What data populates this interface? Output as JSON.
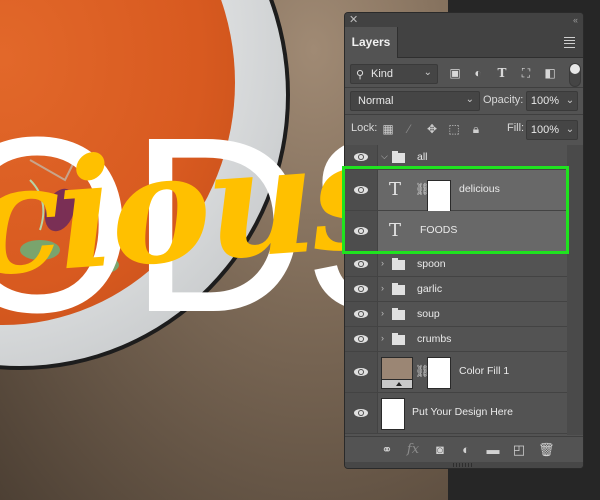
{
  "canvas": {
    "foods_text": "ODS",
    "delicious_text": "cious",
    "colors": {
      "text_white": "#ffffff",
      "text_yellow": "#ffc000",
      "soup": "#d85a20",
      "background": "#7d6a57"
    }
  },
  "panel": {
    "close_icon": "close-icon",
    "collapse_icon": "double-chevron-left-icon",
    "tab_label": "Layers",
    "menu_icon": "hamburger-menu-icon",
    "filter": {
      "kind_label": "Kind",
      "icons": [
        "image-filter-icon",
        "adjustment-filter-icon",
        "type-filter-icon",
        "shape-filter-icon",
        "smart-object-filter-icon"
      ]
    },
    "blend_mode": "Normal",
    "opacity_label": "Opacity:",
    "opacity_value": "100%",
    "lock_label": "Lock:",
    "lock_icons": [
      "lock-transparency-icon",
      "lock-paint-icon",
      "lock-position-icon",
      "lock-artboard-icon",
      "lock-all-icon"
    ],
    "fill_label": "Fill:",
    "fill_value": "100%",
    "layers": [
      {
        "name": "all",
        "type": "group",
        "expanded": true,
        "visible": true
      },
      {
        "name": "delicious",
        "type": "text",
        "has_mask": true,
        "visible": true,
        "selected": true
      },
      {
        "name": "FOODS",
        "type": "text",
        "visible": true,
        "selected": true
      },
      {
        "name": "spoon",
        "type": "group",
        "expanded": false,
        "visible": true
      },
      {
        "name": "garlic",
        "type": "group",
        "expanded": false,
        "visible": true
      },
      {
        "name": "soup",
        "type": "group",
        "expanded": false,
        "visible": true
      },
      {
        "name": "crumbs",
        "type": "group",
        "expanded": false,
        "visible": true
      },
      {
        "name": "Color Fill 1",
        "type": "fill",
        "has_mask": true,
        "visible": true,
        "fill_color": "#9b8674"
      },
      {
        "name": "Put Your Design Here",
        "type": "smart-object",
        "visible": true
      }
    ],
    "bottom_icons": [
      "link-layers-icon",
      "fx-icon",
      "add-mask-icon",
      "adjustment-layer-icon",
      "new-group-icon",
      "new-layer-icon",
      "delete-icon"
    ],
    "highlight_color": "#1fe31f"
  }
}
